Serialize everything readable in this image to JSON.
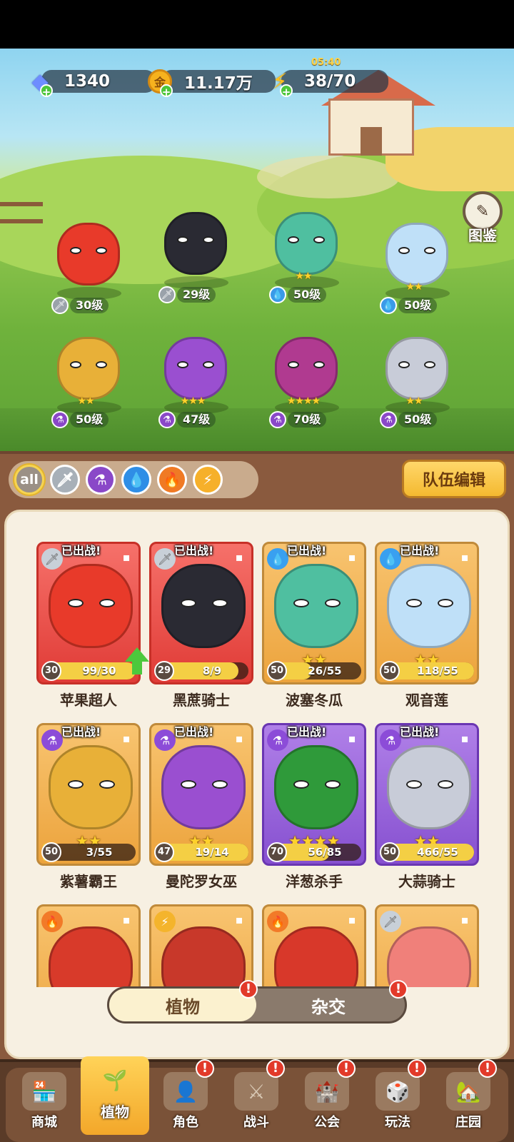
{
  "resources": {
    "gems": "1340",
    "coins": "11.17万",
    "energy": "38/70",
    "energy_timer": "05:40"
  },
  "codex_label": "图鉴",
  "scene_plants": [
    {
      "level": "30级",
      "stars": "",
      "cls": "sword",
      "color": "#e83a2a"
    },
    {
      "level": "29级",
      "stars": "",
      "cls": "sword",
      "color": "#2a2a33"
    },
    {
      "level": "50级",
      "stars": "★★",
      "cls": "drop",
      "color": "#4fbfa0"
    },
    {
      "level": "50级",
      "stars": "★★",
      "cls": "drop",
      "color": "#bfe0f8"
    },
    {
      "level": "50级",
      "stars": "★★",
      "cls": "potion",
      "color": "#e8b038"
    },
    {
      "level": "47级",
      "stars": "★★★",
      "cls": "potion",
      "color": "#9a4fd0"
    },
    {
      "level": "70级",
      "stars": "★★★★",
      "cls": "potion",
      "color": "#b03a90"
    },
    {
      "level": "50级",
      "stars": "★★",
      "cls": "potion",
      "color": "#c8ccd8"
    }
  ],
  "filters": [
    "all"
  ],
  "team_edit_label": "队伍编辑",
  "deployed_badge": "已出战!",
  "cards": [
    {
      "name": "苹果超人",
      "level": "30",
      "progress": "99/30",
      "fill": 1.0,
      "stars": "",
      "cls": "sword",
      "theme": "red",
      "art": "#e83a2a",
      "upgrade": true
    },
    {
      "name": "黑蔗骑士",
      "level": "29",
      "progress": "8/9",
      "fill": 0.89,
      "stars": "",
      "cls": "sword",
      "theme": "red",
      "art": "#2a2a33",
      "upgrade": false
    },
    {
      "name": "波塞冬瓜",
      "level": "50",
      "progress": "26/55",
      "fill": 0.47,
      "stars": "★★",
      "cls": "drop",
      "theme": "gold",
      "art": "#4fbfa0",
      "upgrade": false
    },
    {
      "name": "观音莲",
      "level": "50",
      "progress": "118/55",
      "fill": 1.0,
      "stars": "★★",
      "cls": "drop",
      "theme": "gold",
      "art": "#bfe0f8",
      "upgrade": false
    },
    {
      "name": "紫薯霸王",
      "level": "50",
      "progress": "3/55",
      "fill": 0.05,
      "stars": "★★",
      "cls": "potion",
      "theme": "gold",
      "art": "#e8b038",
      "upgrade": false
    },
    {
      "name": "曼陀罗女巫",
      "level": "47",
      "progress": "19/14",
      "fill": 1.0,
      "stars": "★★",
      "cls": "potion",
      "theme": "gold",
      "art": "#9a4fd0",
      "upgrade": false
    },
    {
      "name": "洋葱杀手",
      "level": "70",
      "progress": "56/85",
      "fill": 0.66,
      "stars": "★★★★",
      "cls": "potion",
      "theme": "purple",
      "art": "#2f9a3a",
      "upgrade": false
    },
    {
      "name": "大蒜骑士",
      "level": "50",
      "progress": "466/55",
      "fill": 1.0,
      "stars": "★★",
      "cls": "potion",
      "theme": "purple",
      "art": "#c8ccd8",
      "upgrade": false
    }
  ],
  "partial_cards": [
    {
      "cls": "fire",
      "art": "#d83a2a"
    },
    {
      "cls": "bolt",
      "art": "#c8382a"
    },
    {
      "cls": "fire",
      "art": "#d8382a"
    },
    {
      "cls": "sword",
      "art": "#f0807a"
    }
  ],
  "tabs": {
    "plants": "植物",
    "hybrid": "杂交",
    "alert": "!"
  },
  "nav": [
    {
      "label": "商城",
      "active": false,
      "alert": false
    },
    {
      "label": "植物",
      "active": true,
      "alert": false
    },
    {
      "label": "角色",
      "active": false,
      "alert": true
    },
    {
      "label": "战斗",
      "active": false,
      "alert": true
    },
    {
      "label": "公会",
      "active": false,
      "alert": true
    },
    {
      "label": "玩法",
      "active": false,
      "alert": true
    },
    {
      "label": "庄园",
      "active": false,
      "alert": true
    }
  ]
}
